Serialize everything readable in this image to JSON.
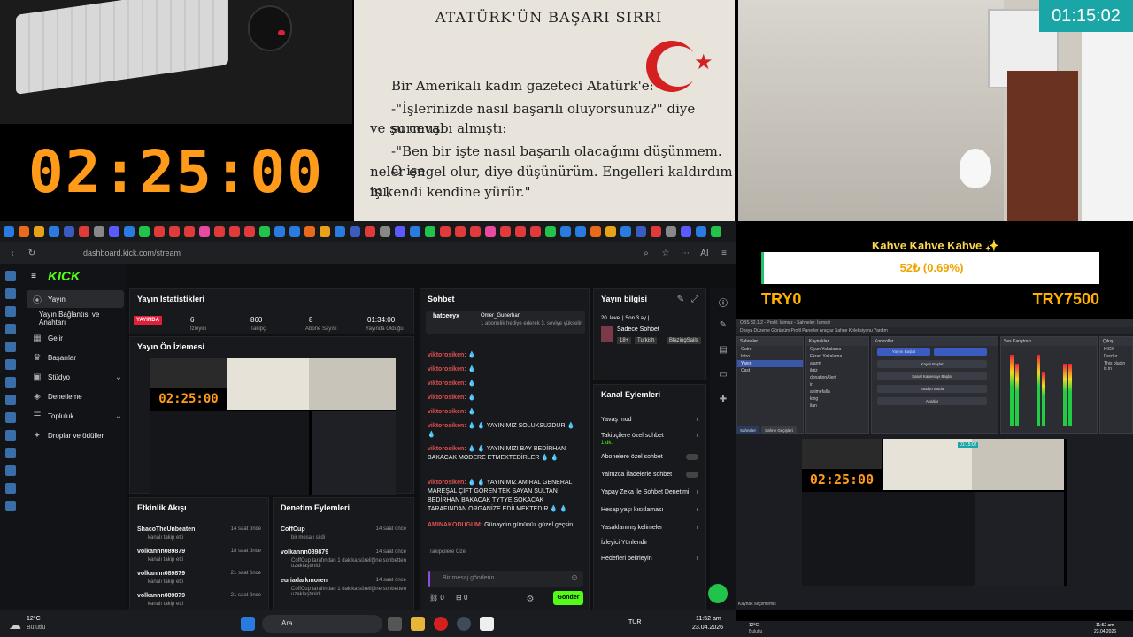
{
  "overlay": {
    "main_timer": "02:25:00",
    "cam_clock": "01:15:02",
    "goal_title": "Kahve Kahve Kahve ✨",
    "goal_progress_text": "52₺ (0.69%)",
    "goal_progress": 0.0069,
    "goal_min": "TRY0",
    "goal_max": "TRY7500"
  },
  "book": {
    "title": "ATATÜRK'ÜN BAŞARI SIRRI",
    "lines": [
      "Bir Amerikalı kadın gazeteci Atatürk'e:",
      "-\"İşlerinizde nasıl başarılı oluyorsunuz?\" diye sormuş",
      "ve şu cevabı almıştı:",
      "-\"Ben bir işte nasıl başarılı olacağımı düşünmem. O işe",
      "neler engel olur, diye düşünürüm. Engelleri kaldırdım mı,",
      "iş kendi kendine yürür.\""
    ]
  },
  "browser": {
    "url": "dashboard.kick.com/stream",
    "ai_label": "AI"
  },
  "sidebar": {
    "logo": "KICK",
    "items": [
      {
        "label": "Yayın",
        "selected": true
      },
      {
        "label": "Yayın Bağlantısı ve Anahtarı"
      },
      {
        "label": "Gelir"
      },
      {
        "label": "Başarılar"
      },
      {
        "label": "Stüdyo"
      },
      {
        "label": "Denetleme"
      },
      {
        "label": "Topluluk"
      },
      {
        "label": "Droplar ve ödüller"
      }
    ]
  },
  "stats": {
    "title": "Yayın İstatistikleri",
    "live_badge": "YAYINDA",
    "viewers": "6",
    "viewers_label": "İzleyici",
    "followers": "860",
    "followers_label": "Takipçi",
    "subs": "8",
    "subs_label": "Abone Sayısı",
    "uptime": "01:34:00",
    "uptime_label": "Yayında Olduğu"
  },
  "preview": {
    "title": "Yayın Ön İzlemesi",
    "timer": "02:25:00"
  },
  "activity": {
    "title": "Etkinlik Akışı",
    "items": [
      {
        "user": "ShacoTheUnbeaten",
        "action": "kanalı takip etti",
        "time": "14 saat önce"
      },
      {
        "user": "volkannn089879",
        "action": "kanalı takip etti",
        "time": "18 saat önce"
      },
      {
        "user": "volkannn089879",
        "action": "kanalı takip etti",
        "time": "21 saat önce"
      },
      {
        "user": "volkannn089879",
        "action": "kanalı takip etti",
        "time": "21 saat önce"
      }
    ]
  },
  "moderation": {
    "title": "Denetim Eylemleri",
    "items": [
      {
        "user": "CoffCup",
        "action": "bir mesajı sildi",
        "time": "14 saat önce"
      },
      {
        "user": "volkannn089879",
        "action": "CoffCup tarafından 1 dakika süreliğine sohbetten uzaklaştırıldı",
        "time": "14 saat önce"
      },
      {
        "user": "euriadarkmoren",
        "action": "CoffCup tarafından 1 dakika süreliğine sohbetten uzaklaştırıldı",
        "time": "14 saat önce"
      }
    ]
  },
  "chat": {
    "title": "Sohbet",
    "pinned_user": "hatceeyx",
    "pinned_text": "Omer_Gunerhan",
    "pinned_sub": "1 abonelik hediye ederek 3. seviye yükselin",
    "lines": [
      {
        "user": "viktorosiken:",
        "text": "💧"
      },
      {
        "user": "viktorosiken:",
        "text": "💧"
      },
      {
        "user": "viktorosiken:",
        "text": "💧"
      },
      {
        "user": "viktorosiken:",
        "text": "💧"
      },
      {
        "user": "viktorosiken:",
        "text": "💧"
      },
      {
        "user": "viktorosiken:",
        "text": "💧 💧 YAYINIMIZ SOLUKSUZDUR 💧 💧"
      },
      {
        "user": "viktorosiken:",
        "text": "💧 💧 YAYINIMIZI BAY BEDİRHAN BAKACAK MODERE ETMEKTEDİRLER 💧 💧"
      },
      {
        "user": "viktorosiken:",
        "text": "💧 💧 YAYINIMIZ AMİRAL GENERAL MAREŞAL ÇİFT GÖREN TEK SAYAN SULTAN BEDİRHAN BAKACAK TYTYE SOKACAK TARAFINDAN ORGANİZE EDİLMEKTEDİR 💧 💧"
      },
      {
        "user": "AMINAKODUGUM:",
        "text": "Günaydın gününüz güzel geçsin"
      }
    ],
    "followers_only": "Takipçilere Özel",
    "input_placeholder": "Bir mesaj gönderin",
    "send": "Gönder",
    "count_a": "0",
    "count_b": "0"
  },
  "stream_info": {
    "title": "Yayın bilgisi",
    "line": "20. level | Son 3 ay |",
    "mode": "Sadece Sohbet",
    "tags": [
      "18+",
      "Turkish",
      "BlazingSails"
    ]
  },
  "channel_actions": {
    "title": "Kanal Eylemleri",
    "items": [
      "Yavaş mod",
      "Takipçilere özel sohbet",
      "Abonelere özel sohbet",
      "Yalnızca İfadelerle sohbet",
      "Yapay Zeka ile Sohbet Denetimi",
      "Hesap yaşı kısıtlaması",
      "Yasaklanmış kelimeler",
      "İzleyici Yönlendir",
      "Hedefleri belirleyin"
    ],
    "sub": "1 dk."
  },
  "obs": {
    "title": "OBS 32.1.2 - Profil: İsimsiz - Sahneler: İsimsiz",
    "menu": "Dosya  Düzenle  Görünüm  Profil  Paneller  Araçlar  Sahne Koleksiyonu  Yardım",
    "scenes_title": "Sahneler",
    "scenes": [
      "Outro",
      "Intro",
      "Yayın",
      "Cast"
    ],
    "sources_title": "Kaynaklar",
    "sources": [
      "Oyun Yakalama",
      "Ekran Yakalama",
      "alarm",
      "ilgiz",
      "donationAlert",
      "irl",
      "animefalla",
      "king",
      "ilan"
    ],
    "controls_title": "Kontroller",
    "controls": [
      "Yayını Başlat",
      "Kaydı Başlat",
      "Sanal Kamerayı Başlat",
      "Stüdyo Modu",
      "Ayarlar"
    ],
    "mixer_title": "Ses Karıştırıcı",
    "tabs": [
      "Sahneler",
      "Sahne Geçişleri"
    ],
    "preview_timer": "02:25:00",
    "preview_clock": "01:15:02",
    "status": "Kaynak seçilmemiş",
    "chat_title": "Çıkış",
    "chat_lines": [
      "KICK",
      "Durdur",
      "This plugin is in"
    ]
  },
  "taskbar": {
    "weather_temp": "12°C",
    "weather_text": "Bulutlu",
    "search": "Ara",
    "lang": "TUR",
    "time": "11:52 am",
    "date": "23.04.2026"
  },
  "taskbar2": {
    "temp": "12°C",
    "text": "Bulutlu",
    "time": "11:52 am",
    "date": "23.04.2026"
  },
  "colors": {
    "kick_green": "#53fc18",
    "timer_orange": "#ff9a1a",
    "chat_user_red": "#e25050"
  }
}
